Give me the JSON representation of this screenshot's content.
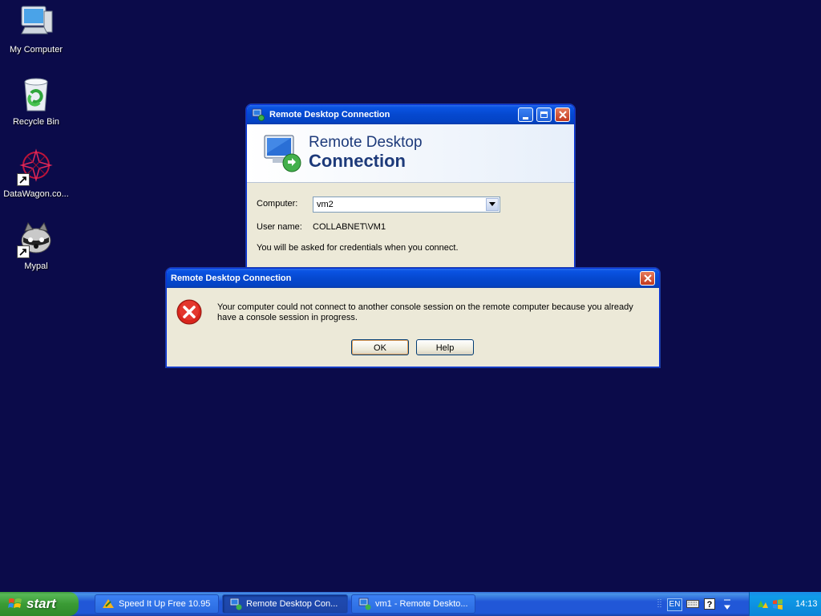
{
  "desktop": {
    "icons": [
      {
        "label": "My Computer",
        "icon": "my-computer-icon"
      },
      {
        "label": "Recycle Bin",
        "icon": "recycle-bin-icon"
      },
      {
        "label": "DataWagon.co...",
        "icon": "datawagon-icon"
      },
      {
        "label": "Mypal",
        "icon": "mypal-icon"
      }
    ]
  },
  "rdp_window": {
    "title": "Remote Desktop Connection",
    "banner_line1": "Remote Desktop",
    "banner_line2": "Connection",
    "computer_label": "Computer:",
    "computer_value": "vm2",
    "username_label": "User name:",
    "username_value": "COLLABNET\\VM1",
    "credentials_note": "You will be asked for credentials when you connect."
  },
  "error_dialog": {
    "title": "Remote Desktop Connection",
    "message": "Your computer could not connect to another console session on the remote computer because you already have a console session in progress.",
    "ok_label": "OK",
    "help_label": "Help"
  },
  "taskbar": {
    "start_label": "start",
    "tasks": [
      {
        "label": "Speed It Up Free 10.95",
        "active": false
      },
      {
        "label": "Remote Desktop Con...",
        "active": true
      },
      {
        "label": "vm1 - Remote Deskto...",
        "active": false
      }
    ],
    "language": "EN",
    "clock": "14:13"
  },
  "colors": {
    "desktop_bg": "#0b0b4a",
    "title_blue": "#0548cf",
    "start_green": "#3a9b35",
    "close_red": "#c2391f"
  }
}
